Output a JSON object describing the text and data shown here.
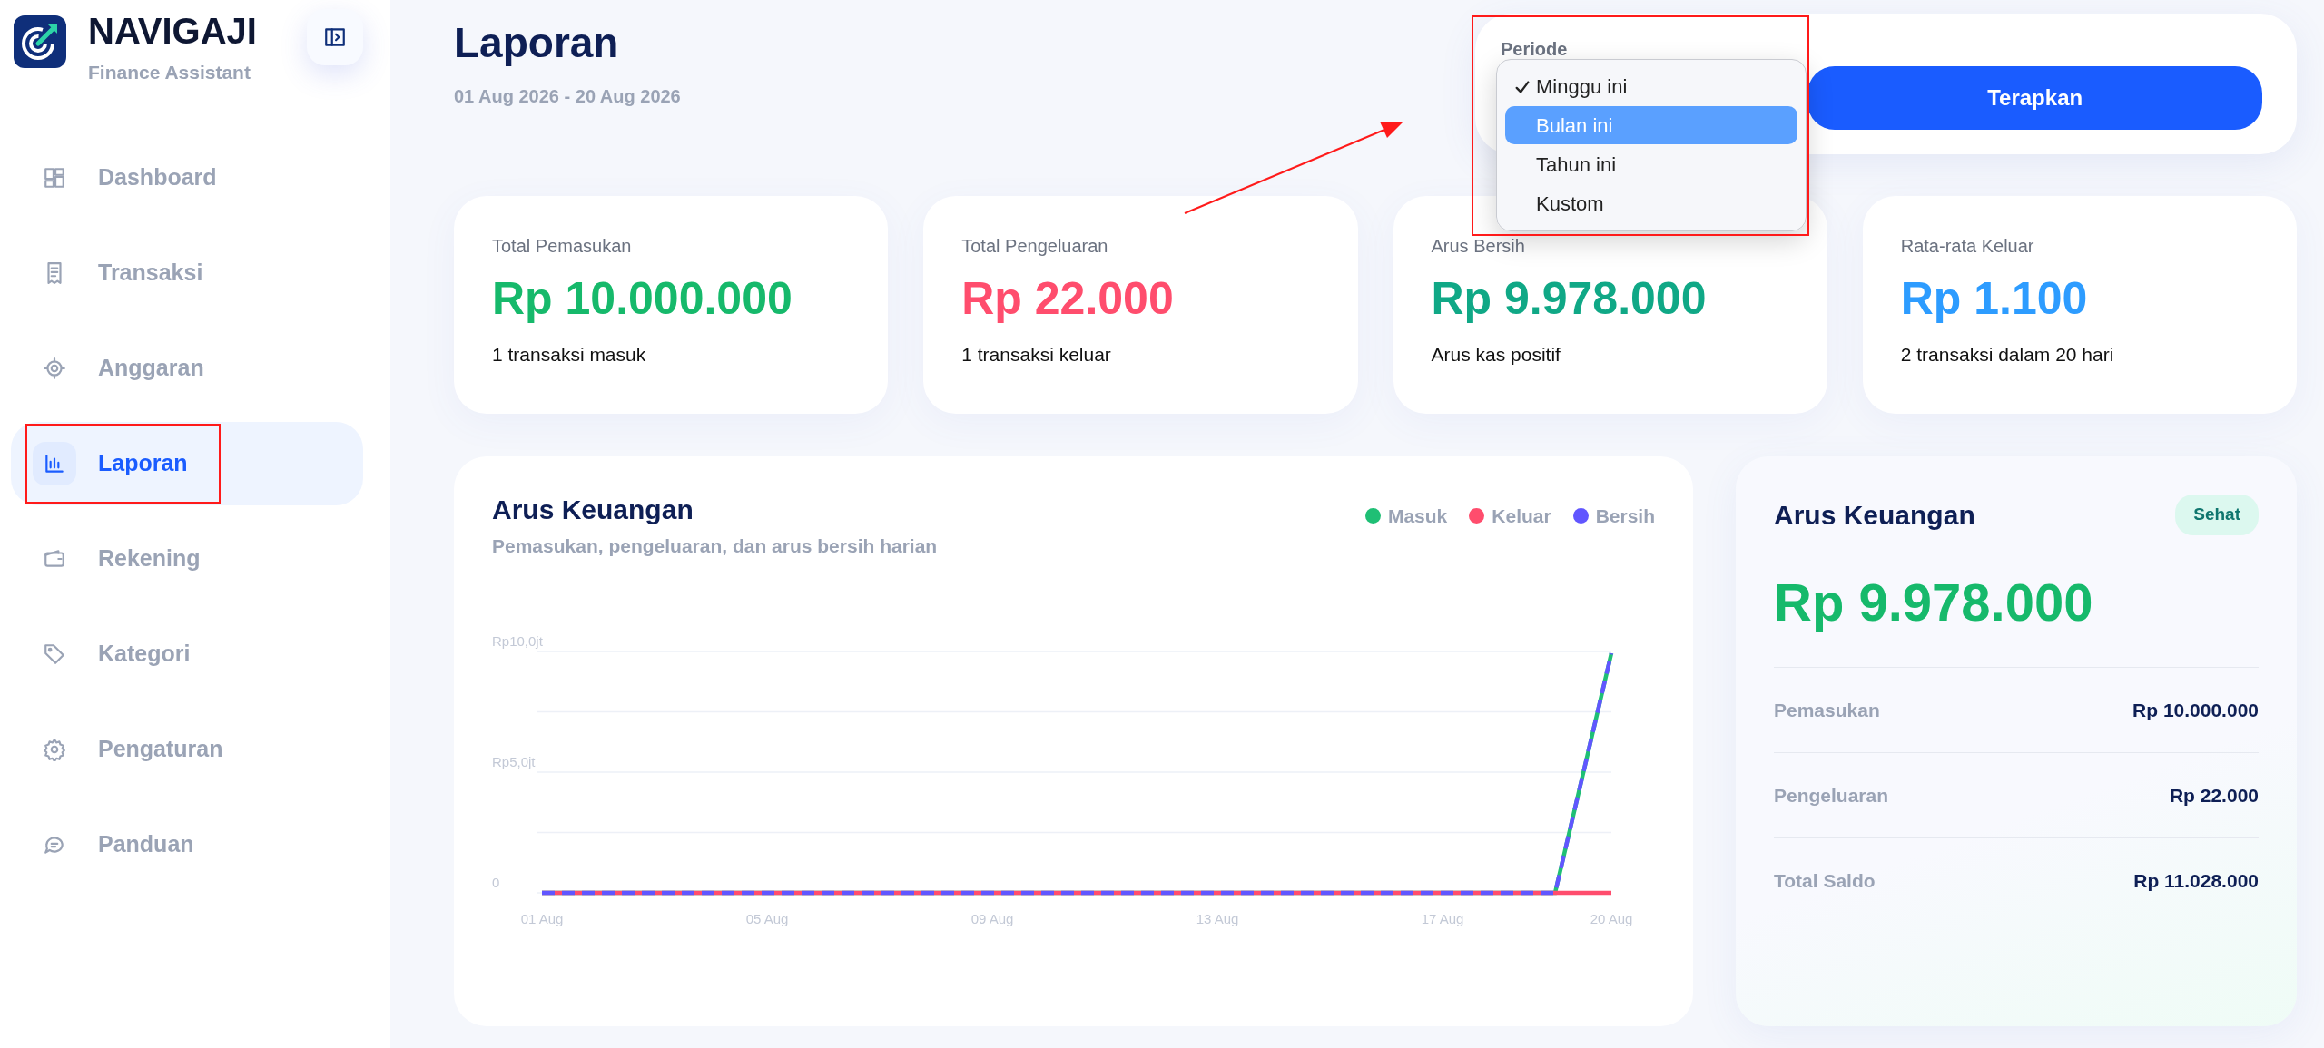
{
  "sidebar": {
    "brand": "NAVIGAJI",
    "tagline": "Finance Assistant",
    "items": [
      {
        "label": "Dashboard",
        "kind": "dashboard",
        "selected": false
      },
      {
        "label": "Transaksi",
        "kind": "receipt",
        "selected": false
      },
      {
        "label": "Anggaran",
        "kind": "target",
        "selected": false
      },
      {
        "label": "Laporan",
        "kind": "chart",
        "selected": true
      },
      {
        "label": "Rekening",
        "kind": "wallet",
        "selected": false
      },
      {
        "label": "Kategori",
        "kind": "tag",
        "selected": false
      },
      {
        "label": "Pengaturan",
        "kind": "gear",
        "selected": false
      },
      {
        "label": "Panduan",
        "kind": "chat",
        "selected": false
      }
    ]
  },
  "header": {
    "title": "Laporan",
    "date_range": "01 Aug 2026 - 20 Aug 2026"
  },
  "period": {
    "label": "Periode",
    "apply_button": "Terapkan",
    "options": [
      {
        "label": "Minggu ini",
        "selected": true,
        "highlighted": false
      },
      {
        "label": "Bulan ini",
        "selected": false,
        "highlighted": true
      },
      {
        "label": "Tahun ini",
        "selected": false,
        "highlighted": false
      },
      {
        "label": "Kustom",
        "selected": false,
        "highlighted": false
      }
    ]
  },
  "stats": [
    {
      "label": "Total Pemasukan",
      "value": "Rp 10.000.000",
      "note": "1 transaksi masuk",
      "color": "#16b96b"
    },
    {
      "label": "Total Pengeluaran",
      "value": "Rp 22.000",
      "note": "1 transaksi keluar",
      "color": "#ff4d6d"
    },
    {
      "label": "Arus Bersih",
      "value": "Rp 9.978.000",
      "note": "Arus kas positif",
      "color": "#10a886"
    },
    {
      "label": "Rata-rata Keluar",
      "value": "Rp 1.100",
      "note": "2 transaksi dalam 20 hari",
      "color": "#2d9cff"
    }
  ],
  "cashflow_chart": {
    "title": "Arus Keuangan",
    "subtitle": "Pemasukan, pengeluaran, dan arus bersih harian",
    "legend": [
      {
        "name": "Masuk",
        "color": "#1fbf75"
      },
      {
        "name": "Keluar",
        "color": "#ff4d6d"
      },
      {
        "name": "Bersih",
        "color": "#6156ff"
      }
    ],
    "y_axis_labels": [
      "Rp10,0jt",
      "Rp5,0jt",
      "0"
    ],
    "x_axis_labels": [
      "01 Aug",
      "05 Aug",
      "09 Aug",
      "13 Aug",
      "17 Aug",
      "20 Aug"
    ]
  },
  "summary": {
    "title": "Arus Keuangan",
    "badge": "Sehat",
    "value": "Rp 9.978.000",
    "rows": [
      {
        "label": "Pemasukan",
        "value": "Rp 10.000.000"
      },
      {
        "label": "Pengeluaran",
        "value": "Rp 22.000"
      },
      {
        "label": "Total Saldo",
        "value": "Rp 11.028.000"
      }
    ]
  },
  "annotations": {
    "highlight_selected_nav": true,
    "highlight_period": true,
    "arrow_to_period": true
  }
}
